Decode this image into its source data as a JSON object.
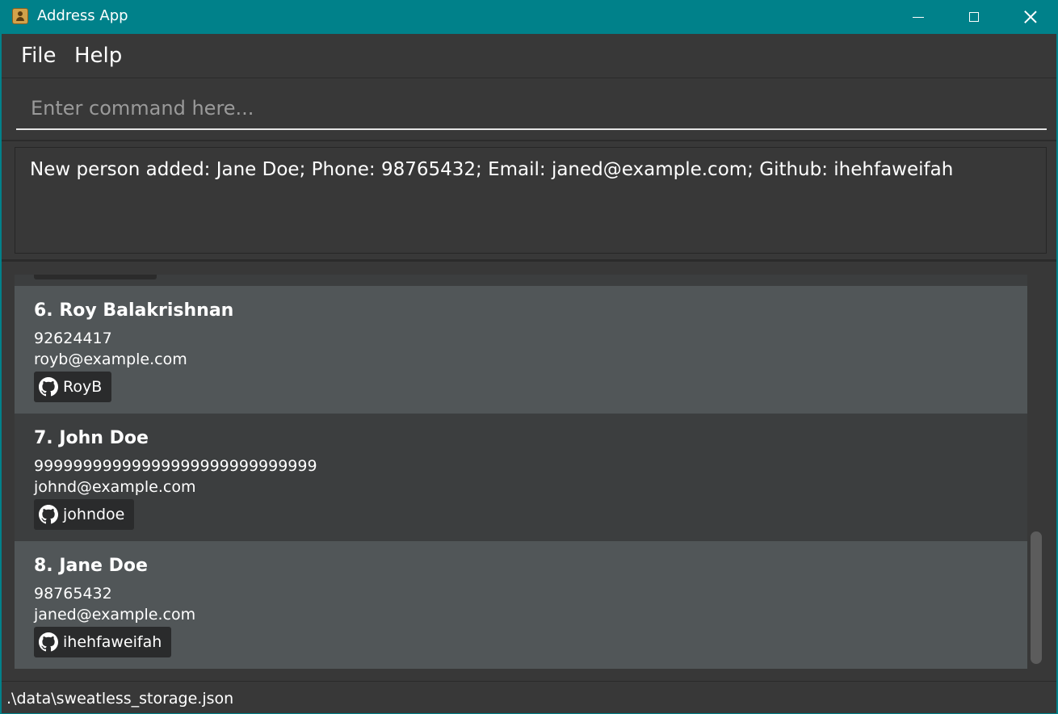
{
  "window": {
    "title": "Address App",
    "icon": "address-book-icon",
    "controls": [
      "minimize-icon",
      "maximize-icon",
      "close-icon"
    ]
  },
  "menu": {
    "file": "File",
    "help": "Help"
  },
  "command": {
    "placeholder": "Enter command here...",
    "value": ""
  },
  "result": {
    "message": "New person added: Jane Doe; Phone: 98765432; Email: janed@example.com; Github: ihehfaweifah"
  },
  "persons": [
    {
      "name": "6. Roy Balakrishnan",
      "phone": "92624417",
      "email": "royb@example.com",
      "github": "RoyB"
    },
    {
      "name": "7. John Doe",
      "phone": "99999999999999999999999999999",
      "email": "johnd@example.com",
      "github": "johndoe"
    },
    {
      "name": "8. Jane Doe",
      "phone": "98765432",
      "email": "janed@example.com",
      "github": "ihehfaweifah"
    }
  ],
  "status": {
    "path": ".\\data\\sweatless_storage.json"
  },
  "colors": {
    "titlebar": "#00818a",
    "background": "#383838",
    "card_even": "#515658",
    "card_odd": "#3c3e3f",
    "tag": "#2a2b2c"
  }
}
